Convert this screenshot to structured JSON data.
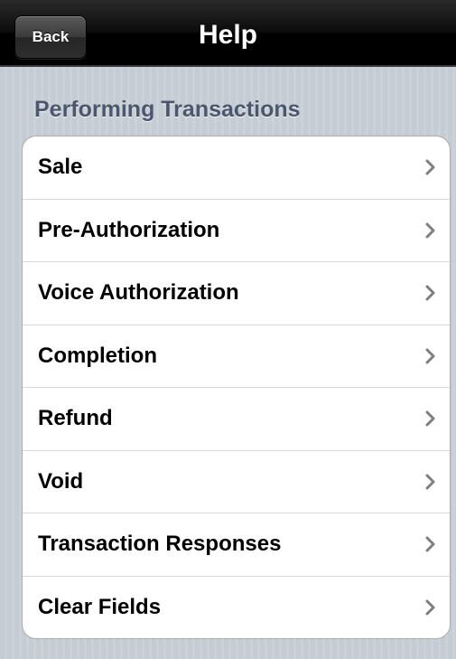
{
  "nav_bar": {
    "back_label": "Back",
    "title": "Help"
  },
  "section": {
    "header": "Performing Transactions",
    "items": [
      {
        "label": "Sale",
        "icon": "chevron-right-icon"
      },
      {
        "label": "Pre-Authorization",
        "icon": "chevron-right-icon"
      },
      {
        "label": "Voice Authorization",
        "icon": "chevron-right-icon"
      },
      {
        "label": "Completion",
        "icon": "chevron-right-icon"
      },
      {
        "label": "Refund",
        "icon": "chevron-right-icon"
      },
      {
        "label": "Void",
        "icon": "chevron-right-icon"
      },
      {
        "label": "Transaction Responses",
        "icon": "chevron-right-icon"
      },
      {
        "label": "Clear Fields",
        "icon": "chevron-right-icon"
      }
    ]
  },
  "colors": {
    "background": "#c5ccd4",
    "nav_bar": "#000000",
    "section_header_text": "#4c566c",
    "cell_background": "#ffffff",
    "chevron": "#7f7f7f"
  }
}
